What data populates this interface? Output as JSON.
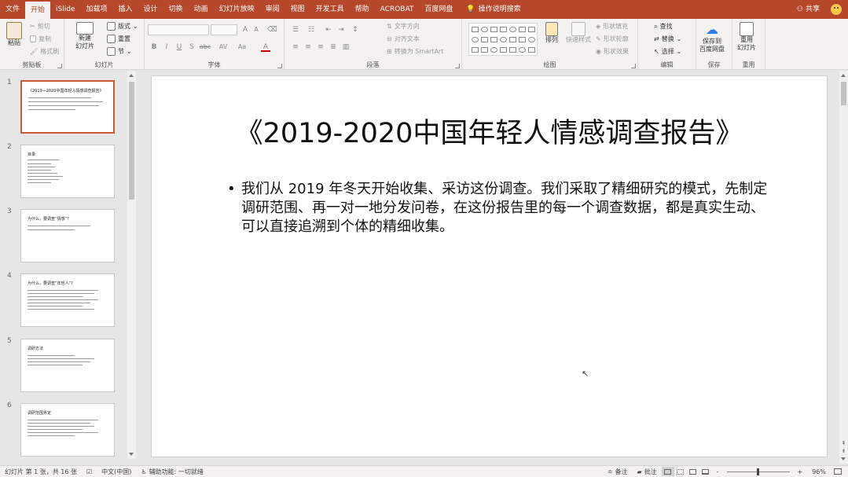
{
  "tabs": [
    "文件",
    "开始",
    "iSlide",
    "加载项",
    "插入",
    "设计",
    "切换",
    "动画",
    "幻灯片放映",
    "审阅",
    "视图",
    "开发工具",
    "帮助",
    "ACROBAT",
    "百度网盘"
  ],
  "active_tab": "开始",
  "tell_me": "操作说明搜索",
  "share": "共享",
  "ribbon": {
    "clipboard": {
      "paste": "粘贴",
      "cut": "剪切",
      "copy": "复制",
      "format_painter": "格式刷",
      "label": "剪贴板"
    },
    "slides": {
      "new_slide": "新建\n幻灯片",
      "layout": "版式",
      "reset": "重置",
      "section": "节",
      "label": "幻灯片"
    },
    "font": {
      "label": "字体",
      "bold": "B",
      "italic": "I",
      "underline": "U",
      "strike": "S",
      "shadow": "abc",
      "spacing": "AV",
      "case": "Aa",
      "color": "A",
      "grow": "A",
      "shrink": "A"
    },
    "paragraph": {
      "label": "段落",
      "text_direction": "文字方向",
      "align_text": "对齐文本",
      "smartart": "转换为 SmartArt"
    },
    "drawing": {
      "label": "绘图",
      "arrange": "排列",
      "quick_styles": "快速样式",
      "shape_fill": "形状填充",
      "shape_outline": "形状轮廓",
      "shape_effects": "形状效果"
    },
    "editing": {
      "label": "编辑",
      "find": "查找",
      "replace": "替换",
      "select": "选择"
    },
    "save": {
      "label": "保存",
      "button": "保存到\n百度网盘"
    },
    "reuse": {
      "label": "重用",
      "button": "重用\n幻灯片"
    }
  },
  "thumbnails": [
    {
      "num": "1",
      "title": "《2019—2020中国年轻人情感调查报告》"
    },
    {
      "num": "2",
      "title": "目录"
    },
    {
      "num": "3",
      "title": "为什么，要调查“情感”？"
    },
    {
      "num": "4",
      "title": "为什么，要调查“年轻人”？"
    },
    {
      "num": "5",
      "title": "调研方法"
    },
    {
      "num": "6",
      "title": "调研范围界定"
    }
  ],
  "slide": {
    "title": "《2019-2020中国年轻人情感调查报告》",
    "bullet": "我们从 2019 年冬天开始收集、采访这份调查。我们采取了精细研究的模式，先制定调研范围、再一对一地分发问卷，在这份报告里的每一个调查数据，都是真实生动、可以直接追溯到个体的精细收集。"
  },
  "status": {
    "slide_info": "幻灯片 第 1 张，共 16 张",
    "language": "中文(中国)",
    "accessibility": "辅助功能: 一切就绪",
    "notes": "备注",
    "comments": "批注",
    "zoom": "96%",
    "zoom_minus": "-",
    "zoom_plus": "+"
  }
}
